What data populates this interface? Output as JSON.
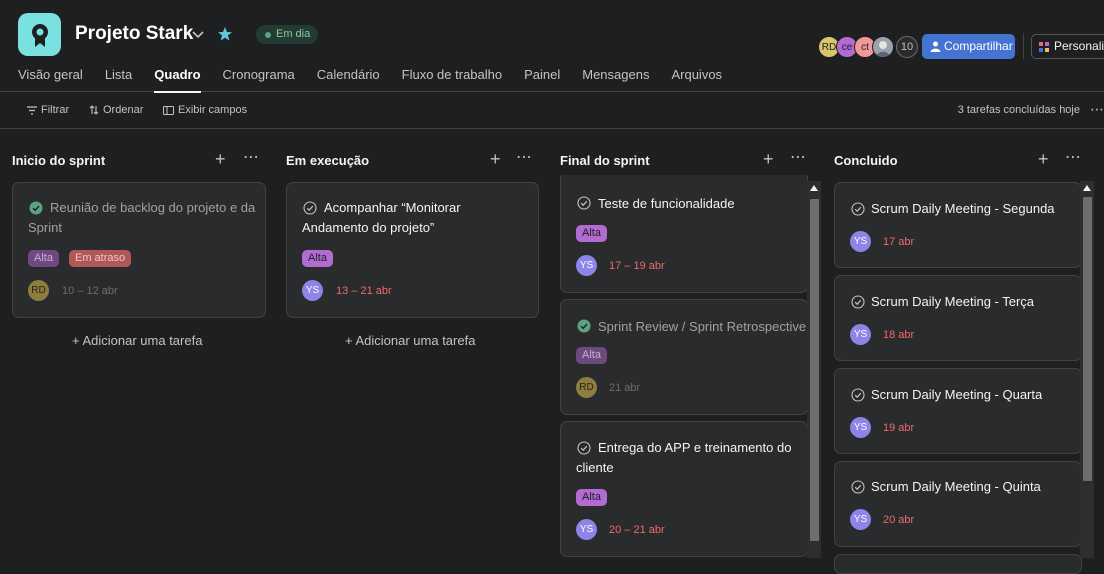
{
  "project": {
    "title": "Projeto Stark",
    "status": "Em dia"
  },
  "members": {
    "avatars": [
      {
        "initials": "RD",
        "color": "#d9c56b"
      },
      {
        "initials": "ce",
        "color": "#b36bd4"
      },
      {
        "initials": "ct",
        "color": "#f09999"
      },
      {
        "initials": "",
        "color": "#9aa3ad"
      }
    ],
    "count": "10"
  },
  "header": {
    "share_label": "Compartilhar",
    "customize_label": "Personalizar"
  },
  "tabs": [
    {
      "label": "Visão geral"
    },
    {
      "label": "Lista"
    },
    {
      "label": "Quadro"
    },
    {
      "label": "Cronograma"
    },
    {
      "label": "Calendário"
    },
    {
      "label": "Fluxo de trabalho"
    },
    {
      "label": "Painel"
    },
    {
      "label": "Mensagens"
    },
    {
      "label": "Arquivos"
    }
  ],
  "toolbar": {
    "filter_label": "Filtrar",
    "sort_label": "Ordenar",
    "fields_label": "Exibir campos",
    "done_today": "3 tarefas concluídas hoje"
  },
  "board": {
    "add_task_label": "+ Adicionar uma tarefa",
    "columns": [
      {
        "title": "Inicio do sprint",
        "cards": [
          {
            "title_line1": "Reunião de backlog do projeto e da",
            "title_line2": "Sprint",
            "tag1": "Alta",
            "tag2": "Em atraso",
            "assignee": "RD",
            "date": "10 – 12 abr"
          }
        ]
      },
      {
        "title": "Em execução",
        "cards": [
          {
            "title_line1": "Acompanhar “Monitorar",
            "title_line2": "Andamento do projeto”",
            "tag1": "Alta",
            "assignee": "YS",
            "date": "13 – 21 abr"
          }
        ]
      },
      {
        "title": "Final do sprint",
        "cards": [
          {
            "title_line1": "Teste de funcionalidade",
            "tag1": "Alta",
            "assignee": "YS",
            "date": "17 – 19 abr"
          },
          {
            "title_line1": "Sprint Review / Sprint Retrospective",
            "tag1": "Alta",
            "assignee": "RD",
            "date": "21 abr"
          },
          {
            "title_line1": "Entrega do APP e treinamento do",
            "title_line2": "cliente",
            "tag1": "Alta",
            "assignee": "YS",
            "date": "20 – 21 abr"
          }
        ]
      },
      {
        "title": "Concluido",
        "cards": [
          {
            "title_line1": "Scrum Daily Meeting - Segunda",
            "assignee": "YS",
            "date": "17 abr"
          },
          {
            "title_line1": "Scrum Daily Meeting - Terça",
            "assignee": "YS",
            "date": "18 abr"
          },
          {
            "title_line1": "Scrum Daily Meeting - Quarta",
            "assignee": "YS",
            "date": "19 abr"
          },
          {
            "title_line1": "Scrum Daily Meeting - Quinta",
            "assignee": "YS",
            "date": "20 abr"
          }
        ]
      }
    ]
  },
  "colors": {
    "background": "#1e1f21",
    "card": "#2a2b2d",
    "accent_blue": "#4573d2",
    "tag_alta": "#b36bd4",
    "date_red": "#f06a6a",
    "done_green": "#5da283"
  }
}
